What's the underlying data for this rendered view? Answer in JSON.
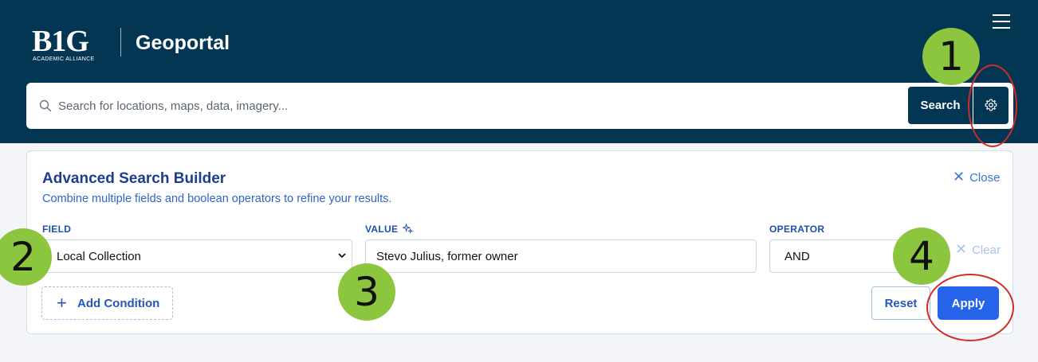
{
  "header": {
    "logo_text": "B1G",
    "logo_subtext": "ACADEMIC ALLIANCE",
    "title": "Geoportal"
  },
  "search": {
    "placeholder": "Search for locations, maps, data, imagery...",
    "button_label": "Search"
  },
  "advanced": {
    "title": "Advanced Search Builder",
    "description": "Combine multiple fields and boolean operators to refine your results.",
    "close_label": "Close",
    "field_label": "FIELD",
    "field_value": "Local Collection",
    "value_label": "VALUE",
    "value_text": "Stevo Julius, former owner",
    "operator_label": "OPERATOR",
    "operator_value": "AND",
    "clear_label": "Clear",
    "add_condition_label": "Add Condition",
    "reset_label": "Reset",
    "apply_label": "Apply"
  },
  "annotations": {
    "callouts": [
      "1",
      "2",
      "3",
      "4"
    ],
    "accent_green": "#8cc63f",
    "ring_color": "#d42a2a"
  },
  "colors": {
    "header_bg": "#033652",
    "primary_button": "#2563eb"
  }
}
